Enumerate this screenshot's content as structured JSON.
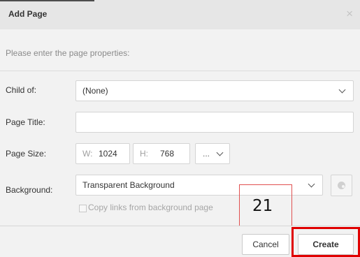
{
  "dialog": {
    "title": "Add Page",
    "close_glyph": "×",
    "instructions": "Please enter the page properties:"
  },
  "form": {
    "child_of": {
      "label": "Child of:",
      "value": "(None)"
    },
    "page_title": {
      "label": "Page Title:",
      "value": "",
      "placeholder": ""
    },
    "page_size": {
      "label": "Page Size:",
      "width_label": "W:",
      "width_value": "1024",
      "height_label": "H:",
      "height_value": "768",
      "preset_label": "..."
    },
    "background": {
      "label": "Background:",
      "value": "Transparent Background",
      "copy_links_label": "Copy links from background page",
      "copy_links_checked": false,
      "icon": "palette-icon"
    }
  },
  "annotation": {
    "number": "21",
    "color": "#e00000"
  },
  "footer": {
    "cancel_label": "Cancel",
    "create_label": "Create"
  },
  "colors": {
    "dialog_bg": "#f2f2f2",
    "header_bg": "#e6e6e6",
    "highlight": "#e00000"
  }
}
